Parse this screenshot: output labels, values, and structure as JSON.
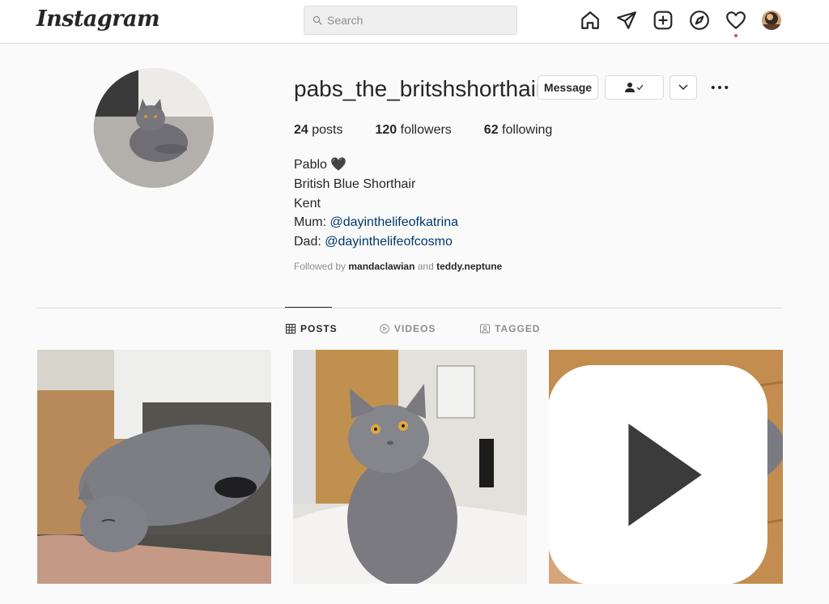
{
  "nav": {
    "logo": "Instagram",
    "search_placeholder": "Search",
    "icons": [
      "home-icon",
      "direct-icon",
      "new-post-icon",
      "explore-icon",
      "activity-icon",
      "profile-avatar"
    ]
  },
  "profile": {
    "username": "pabs_the_britshshorthair",
    "message_label": "Message",
    "stats": {
      "posts_count": "24",
      "posts_label": "posts",
      "followers_count": "120",
      "followers_label": "followers",
      "following_count": "62",
      "following_label": "following"
    },
    "bio": {
      "name": "Pablo",
      "emoji": "🖤",
      "line2": "British Blue Shorthair",
      "line3": "Kent",
      "mum_prefix": "Mum: ",
      "mum_handle": "@dayinthelifeofkatrina",
      "dad_prefix": "Dad: ",
      "dad_handle": "@dayinthelifeofcosmo"
    },
    "followed_by": {
      "prefix": "Followed by ",
      "user1": "mandaclawian",
      "joiner": " and ",
      "user2": "teddy.neptune"
    }
  },
  "tabs": [
    {
      "label": "POSTS",
      "active": true
    },
    {
      "label": "VIDEOS",
      "active": false
    },
    {
      "label": "TAGGED",
      "active": false
    }
  ],
  "posts": [
    {
      "type": "image"
    },
    {
      "type": "image"
    },
    {
      "type": "video"
    }
  ],
  "colors": {
    "link": "#00376b",
    "border": "#dbdbdb",
    "text": "#262626",
    "muted": "#8e8e8e",
    "notification": "#ed4956"
  }
}
